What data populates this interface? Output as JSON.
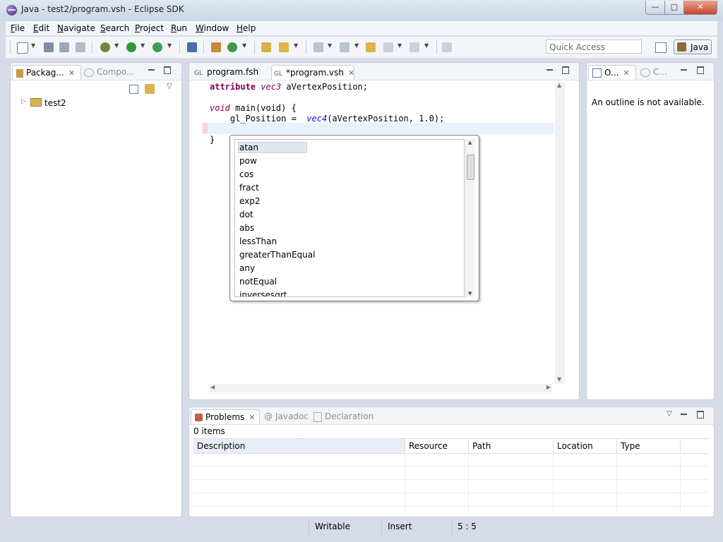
{
  "window": {
    "title": "Java - test2/program.vsh - Eclipse SDK"
  },
  "menu": [
    "File",
    "Edit",
    "Navigate",
    "Search",
    "Project",
    "Run",
    "Window",
    "Help"
  ],
  "toolbar": {
    "quick_access_placeholder": "Quick Access",
    "perspective_label": "Java"
  },
  "left_panel": {
    "tabs": [
      {
        "label": "Packag..."
      },
      {
        "label": "Compo..."
      }
    ],
    "tree": [
      {
        "label": "test2"
      }
    ]
  },
  "editor": {
    "tabs": [
      {
        "prefix": "GL",
        "label": "program.fsh"
      },
      {
        "prefix": "GL",
        "label": "*program.vsh"
      }
    ],
    "code": {
      "line1_kw": "attribute",
      "line1_type": "vec3",
      "line1_rest": " aVertexPosition;",
      "line3_type": "void",
      "line3_rest": " main(void) {",
      "line4_start": "    gl_Position =  ",
      "line4_fn": "vec4",
      "line4_rest": "(aVertexPosition, 1.0);",
      "line6": "}"
    }
  },
  "completion": {
    "items": [
      "atan",
      "pow",
      "cos",
      "fract",
      "exp2",
      "dot",
      "abs",
      "lessThan",
      "greaterThanEqual",
      "any",
      "notEqual",
      "inversesqrt"
    ],
    "selected": "atan"
  },
  "outline_panel": {
    "tabs": [
      {
        "label": "O..."
      },
      {
        "label": "C..."
      }
    ],
    "message": "An outline is not available."
  },
  "bottom_panel": {
    "tabs": [
      {
        "label": "Problems"
      },
      {
        "label": "Javadoc"
      },
      {
        "label": "Declaration"
      }
    ],
    "count": "0 items",
    "columns": [
      "Description",
      "Resource",
      "Path",
      "Location",
      "Type"
    ]
  },
  "status": {
    "writable": "Writable",
    "insert": "Insert",
    "position": "5 : 5"
  }
}
